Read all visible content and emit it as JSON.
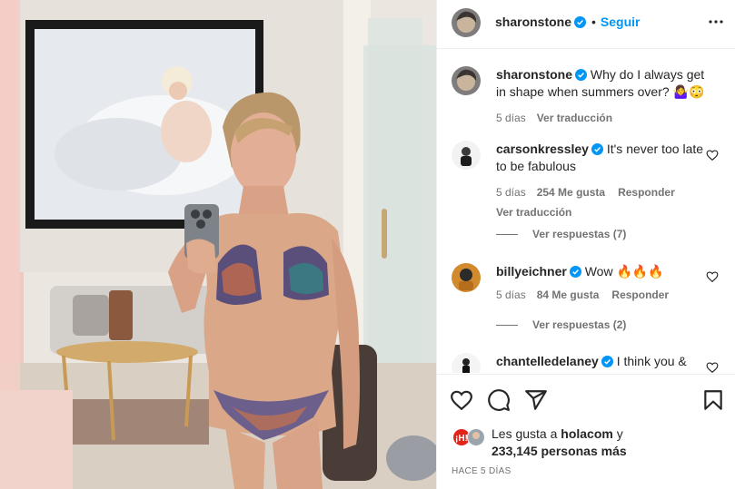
{
  "post": {
    "author": "sharonstone",
    "follow_label": "Seguir",
    "dot": "•",
    "caption_text": "Why do I always get in shape when summers over? 🤷‍♀️😳",
    "caption_age": "5 días",
    "caption_translate": "Ver traducción"
  },
  "comments": [
    {
      "user": "carsonkressley",
      "text": "It's never too late to be fabulous",
      "age": "5 días",
      "likes": "254 Me gusta",
      "reply": "Responder",
      "translate": "Ver traducción",
      "replies": "Ver respuestas (7)"
    },
    {
      "user": "billyeichner",
      "text": "Wow 🔥🔥🔥",
      "age": "5 días",
      "likes": "84 Me gusta",
      "reply": "Responder",
      "replies": "Ver respuestas (2)"
    },
    {
      "user": "chantelledelaney",
      "text": "I think you &"
    }
  ],
  "likes": {
    "prefix": "Les gusta a",
    "liker": "holacom",
    "joiner": "y",
    "count": "233,145 personas más"
  },
  "timestamp": "HACE 5 DÍAS",
  "icons": {
    "verified": "verified-badge-icon",
    "more": "more-options-icon",
    "like": "heart-icon",
    "comment": "comment-icon",
    "share": "share-icon",
    "save": "bookmark-icon"
  },
  "colors": {
    "link": "#0095f6",
    "muted": "#737373",
    "text": "#262626",
    "verified": "#0095f6"
  }
}
